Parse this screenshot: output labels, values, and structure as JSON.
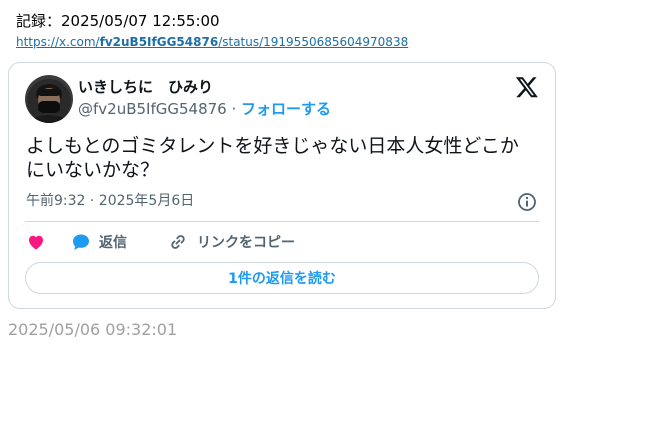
{
  "record": {
    "label": "記録：2025/05/07 12:55:00"
  },
  "source": {
    "prefix": "https://x.com/",
    "user": "fv2uB5IfGG54876",
    "suffix": "/status/1919550685604970838"
  },
  "tweet": {
    "display_name": "いきしちに　ひみり",
    "handle": "@fv2uB5IfGG54876",
    "separator": " · ",
    "follow_label": "フォローする",
    "text": "よしもとのゴミタレントを好きじゃない日本人女性どこかにいないかな？",
    "timestamp": "午前9:32 · 2025年5月6日",
    "actions": {
      "like_icon": "heart-icon",
      "reply_icon": "speech-bubble-icon",
      "reply_label": "返信",
      "copy_icon": "link-icon",
      "copy_label": "リンクをコピー"
    },
    "read_replies_label": "1件の返信を読む"
  },
  "archive_date": "2025/05/06 09:32:01",
  "colors": {
    "accent": "#1d9bf0",
    "like": "#f91880",
    "muted": "#536471",
    "border": "#cfd9de",
    "link": "#1d6fa5"
  }
}
